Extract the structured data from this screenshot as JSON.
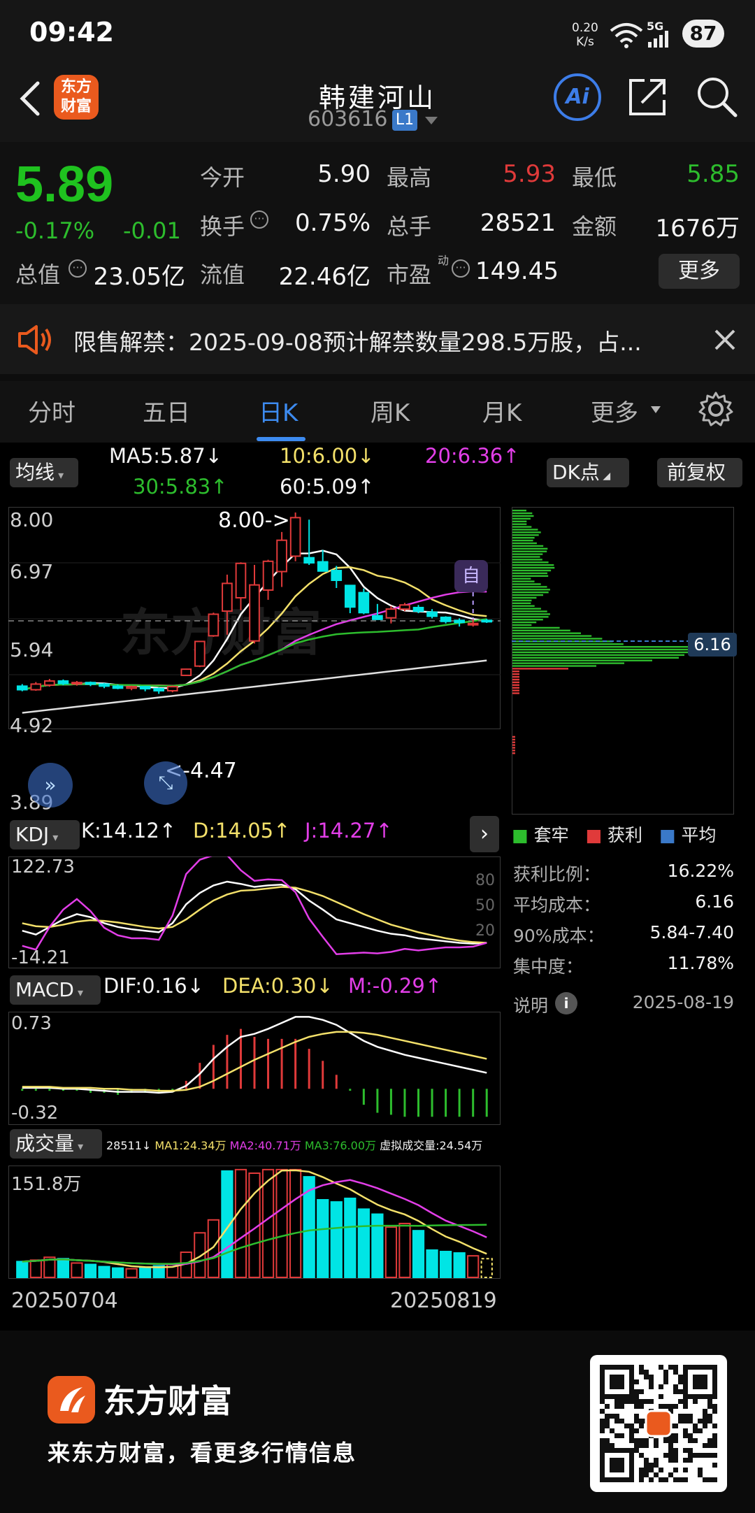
{
  "status_bar": {
    "time": "09:42",
    "net_speed_value": "0.20",
    "net_speed_unit": "K/s",
    "signal_label": "5G",
    "battery": "87"
  },
  "header": {
    "stock_name": "韩建河山",
    "stock_code": "603616",
    "level_badge": "L1",
    "logo_text_top": "东方",
    "logo_text_bottom": "财富",
    "ai_label": "Ai"
  },
  "quote": {
    "price": "5.89",
    "change_pct": "-0.17%",
    "change_amt": "-0.01",
    "rows": [
      [
        {
          "label": "今开",
          "value": "5.90",
          "color": "white"
        },
        {
          "label": "最高",
          "value": "5.93",
          "color": "red"
        },
        {
          "label": "最低",
          "value": "5.85",
          "color": "green"
        }
      ],
      [
        {
          "label": "换手",
          "value": "0.75%",
          "color": "white"
        },
        {
          "label": "总手",
          "value": "28521",
          "color": "white"
        },
        {
          "label": "金额",
          "value": "1676万",
          "color": "white"
        }
      ]
    ],
    "total_value_label": "总值",
    "total_value": "23.05亿",
    "float_value_label": "流值",
    "float_value": "22.46亿",
    "pe_label": "市盈",
    "pe_sup": "动",
    "pe_value": "149.45",
    "more_label": "更多"
  },
  "notice": {
    "text": "限售解禁：2025-09-08预计解禁数量298.5万股，占..."
  },
  "tabs": [
    {
      "label": "分时",
      "active": false
    },
    {
      "label": "五日",
      "active": false
    },
    {
      "label": "日K",
      "active": true
    },
    {
      "label": "周K",
      "active": false
    },
    {
      "label": "月K",
      "active": false
    },
    {
      "label": "更多",
      "active": false
    }
  ],
  "kline": {
    "ma_selector": "均线",
    "ma5": "MA5:5.87↓",
    "ma10": "10:6.00↓",
    "ma20": "20:6.36↑",
    "ma30": "30:5.83↑",
    "ma60": "60:5.09↑",
    "dk_button": "DK点",
    "adjust_button": "前复权",
    "y_ticks": [
      "8.00",
      "6.97",
      "5.94",
      "4.92",
      "3.89"
    ],
    "high_marker": "8.00->",
    "low_marker": "<-4.47",
    "self_marker": "自",
    "watermark": "东方财富",
    "colors": {
      "up": "#e03a3a",
      "down": "#00e5e5",
      "ma5": "#ffffff",
      "ma10": "#f3e06a",
      "ma20": "#e23ee8",
      "ma30": "#2dbd2d",
      "ma60": "#e0e0e0"
    }
  },
  "chip": {
    "current_cost": "6.16",
    "legend": [
      {
        "label": "套牢",
        "color": "#2dbd2d"
      },
      {
        "label": "获利",
        "color": "#e03a3a"
      },
      {
        "label": "平均",
        "color": "#3a79c9"
      }
    ],
    "stats": [
      {
        "label": "获利比例：",
        "value": "16.22%"
      },
      {
        "label": "平均成本：",
        "value": "6.16"
      },
      {
        "label": "90%成本：",
        "value": "5.84-7.40"
      },
      {
        "label": "集中度：",
        "value": "11.78%"
      }
    ],
    "note_label": "说明",
    "date": "2025-08-19"
  },
  "kdj": {
    "selector": "KDJ",
    "k": "K:14.12↑",
    "d": "D:14.05↑",
    "j": "J:14.27↑",
    "y_top": "122.73",
    "y_bottom": "-14.21",
    "levels": [
      "80",
      "50",
      "20"
    ]
  },
  "macd": {
    "selector": "MACD",
    "dif": "DIF:0.16↓",
    "dea": "DEA:0.30↓",
    "m": "M:-0.29↑",
    "y_top": "0.73",
    "y_bottom": "-0.32"
  },
  "volume": {
    "selector": "成交量",
    "current": "28511↓",
    "ma1": "MA1:24.34万",
    "ma2": "MA2:40.71万",
    "ma3": "MA3:76.00万",
    "virtual": "虚拟成交量:24.54万",
    "y_top": "151.8万",
    "date_start": "20250704",
    "date_end": "20250819"
  },
  "footer": {
    "brand": "东方财富",
    "tagline": "来东方财富，看更多行情信息"
  },
  "chart_data": {
    "type": "candlestick",
    "x": [
      "20250704",
      "20250819"
    ],
    "candles": [
      {
        "o": 4.62,
        "c": 4.55,
        "h": 4.66,
        "l": 4.52
      },
      {
        "o": 4.55,
        "c": 4.66,
        "h": 4.7,
        "l": 4.53
      },
      {
        "o": 4.64,
        "c": 4.72,
        "h": 4.76,
        "l": 4.61
      },
      {
        "o": 4.72,
        "c": 4.67,
        "h": 4.75,
        "l": 4.64
      },
      {
        "o": 4.67,
        "c": 4.69,
        "h": 4.72,
        "l": 4.63
      },
      {
        "o": 4.69,
        "c": 4.66,
        "h": 4.71,
        "l": 4.62
      },
      {
        "o": 4.66,
        "c": 4.62,
        "h": 4.68,
        "l": 4.58
      },
      {
        "o": 4.62,
        "c": 4.58,
        "h": 4.65,
        "l": 4.56
      },
      {
        "o": 4.58,
        "c": 4.61,
        "h": 4.63,
        "l": 4.54
      },
      {
        "o": 4.61,
        "c": 4.57,
        "h": 4.62,
        "l": 4.52
      },
      {
        "o": 4.57,
        "c": 4.53,
        "h": 4.59,
        "l": 4.47
      },
      {
        "o": 4.53,
        "c": 4.61,
        "h": 4.63,
        "l": 4.5
      },
      {
        "o": 4.83,
        "c": 4.95,
        "h": 4.96,
        "l": 4.82
      },
      {
        "o": 5.01,
        "c": 5.49,
        "h": 5.49,
        "l": 4.99
      },
      {
        "o": 5.6,
        "c": 6.02,
        "h": 6.05,
        "l": 5.58
      },
      {
        "o": 6.08,
        "c": 6.62,
        "h": 6.79,
        "l": 5.62
      },
      {
        "o": 6.34,
        "c": 7.01,
        "h": 7.03,
        "l": 6.1
      },
      {
        "o": 5.5,
        "c": 6.59,
        "h": 6.98,
        "l": 5.45
      },
      {
        "o": 6.49,
        "c": 7.05,
        "h": 7.08,
        "l": 6.3
      },
      {
        "o": 6.85,
        "c": 7.46,
        "h": 7.62,
        "l": 6.55
      },
      {
        "o": 7.15,
        "c": 7.9,
        "h": 8.0,
        "l": 7.05
      },
      {
        "o": 7.12,
        "c": 7.02,
        "h": 7.86,
        "l": 6.98
      },
      {
        "o": 7.04,
        "c": 6.86,
        "h": 7.27,
        "l": 6.86
      },
      {
        "o": 6.87,
        "c": 6.68,
        "h": 6.96,
        "l": 6.53
      },
      {
        "o": 6.58,
        "c": 6.16,
        "h": 6.58,
        "l": 6.04
      },
      {
        "o": 6.44,
        "c": 6.05,
        "h": 6.52,
        "l": 6.02
      },
      {
        "o": 5.99,
        "c": 5.92,
        "h": 6.22,
        "l": 5.92
      },
      {
        "o": 5.95,
        "c": 6.12,
        "h": 6.18,
        "l": 5.84
      },
      {
        "o": 6.12,
        "c": 6.2,
        "h": 6.24,
        "l": 6.08
      },
      {
        "o": 6.15,
        "c": 6.08,
        "h": 6.2,
        "l": 6.04
      },
      {
        "o": 6.06,
        "c": 5.98,
        "h": 6.12,
        "l": 5.94
      },
      {
        "o": 5.96,
        "c": 5.88,
        "h": 5.98,
        "l": 5.84
      },
      {
        "o": 5.9,
        "c": 5.86,
        "h": 5.94,
        "l": 5.78
      },
      {
        "o": 5.82,
        "c": 5.84,
        "h": 5.92,
        "l": 5.78
      },
      {
        "o": 5.9,
        "c": 5.89,
        "h": 5.93,
        "l": 5.85
      }
    ],
    "ylim": [
      3.89,
      8.0
    ],
    "volume": [
      22,
      24,
      28,
      26,
      20,
      18,
      15,
      13,
      12,
      14,
      16,
      18,
      35,
      62,
      80,
      148,
      150,
      145,
      150,
      150,
      150,
      140,
      108,
      105,
      110,
      95,
      88,
      70,
      75,
      65,
      38,
      36,
      34,
      30,
      26
    ],
    "volume_up": [
      false,
      true,
      true,
      false,
      true,
      false,
      false,
      false,
      true,
      false,
      false,
      true,
      true,
      true,
      true,
      false,
      true,
      true,
      true,
      true,
      true,
      false,
      false,
      false,
      false,
      false,
      false,
      true,
      true,
      false,
      false,
      false,
      false,
      true,
      false
    ],
    "volume_ylim": [
      0,
      151.8
    ],
    "kdj_ylim": [
      -14.21,
      122.73
    ],
    "k": [
      30,
      25,
      35,
      45,
      52,
      48,
      40,
      35,
      32,
      30,
      28,
      40,
      65,
      80,
      90,
      95,
      92,
      88,
      90,
      91,
      85,
      70,
      58,
      45,
      40,
      35,
      30,
      26,
      24,
      20,
      18,
      16,
      14,
      13,
      14
    ],
    "d": [
      40,
      36,
      35,
      38,
      42,
      44,
      43,
      41,
      38,
      35,
      33,
      35,
      45,
      58,
      70,
      78,
      83,
      84,
      86,
      88,
      87,
      82,
      76,
      68,
      60,
      52,
      45,
      38,
      33,
      28,
      24,
      20,
      17,
      15,
      14
    ],
    "j": [
      10,
      5,
      35,
      58,
      72,
      56,
      34,
      24,
      20,
      20,
      18,
      50,
      105,
      124,
      130,
      130,
      110,
      96,
      98,
      97,
      81,
      46,
      22,
      -1,
      0,
      1,
      0,
      2,
      6,
      4,
      6,
      8,
      8,
      9,
      14
    ],
    "macd_ylim": [
      -0.32,
      0.73
    ],
    "dif": [
      0.01,
      0.01,
      0.01,
      0.0,
      0.0,
      -0.01,
      -0.02,
      -0.03,
      -0.03,
      -0.03,
      -0.04,
      -0.03,
      0.03,
      0.15,
      0.3,
      0.42,
      0.52,
      0.55,
      0.6,
      0.66,
      0.72,
      0.72,
      0.69,
      0.64,
      0.56,
      0.48,
      0.42,
      0.38,
      0.34,
      0.31,
      0.28,
      0.25,
      0.22,
      0.19,
      0.16
    ],
    "dea": [
      0.02,
      0.02,
      0.02,
      0.01,
      0.01,
      0.01,
      0.0,
      0.0,
      -0.01,
      -0.01,
      -0.02,
      -0.02,
      -0.01,
      0.02,
      0.08,
      0.15,
      0.22,
      0.29,
      0.35,
      0.41,
      0.47,
      0.52,
      0.55,
      0.57,
      0.57,
      0.56,
      0.54,
      0.51,
      0.48,
      0.45,
      0.42,
      0.39,
      0.36,
      0.33,
      0.3
    ]
  }
}
